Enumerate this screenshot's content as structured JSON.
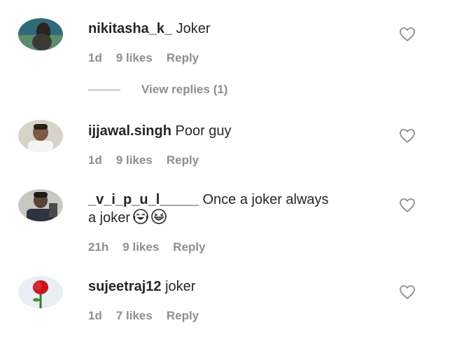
{
  "comments": [
    {
      "username": "nikitasha_k_",
      "text": " Joker",
      "time": "1d",
      "likes": "9 likes",
      "reply": "Reply",
      "view_replies": "View replies (1)"
    },
    {
      "username": "ijjawal.singh",
      "text": " Poor guy",
      "time": "1d",
      "likes": "9 likes",
      "reply": "Reply"
    },
    {
      "username": "_v_i_p_u_l_____",
      "text": " Once a joker always a joker",
      "time": "21h",
      "likes": "9 likes",
      "reply": "Reply"
    },
    {
      "username": "sujeetraj12",
      "text": " joker",
      "time": "1d",
      "likes": "7 likes",
      "reply": "Reply"
    }
  ],
  "icons": {
    "like": "heart-outline-icon",
    "emoji_1": "face-with-tears-of-joy-icon",
    "emoji_2": "grinning-squinting-face-icon"
  },
  "colors": {
    "text": "#262626",
    "meta": "#8e8e8e",
    "heart_stroke": "#8e8e8e"
  }
}
